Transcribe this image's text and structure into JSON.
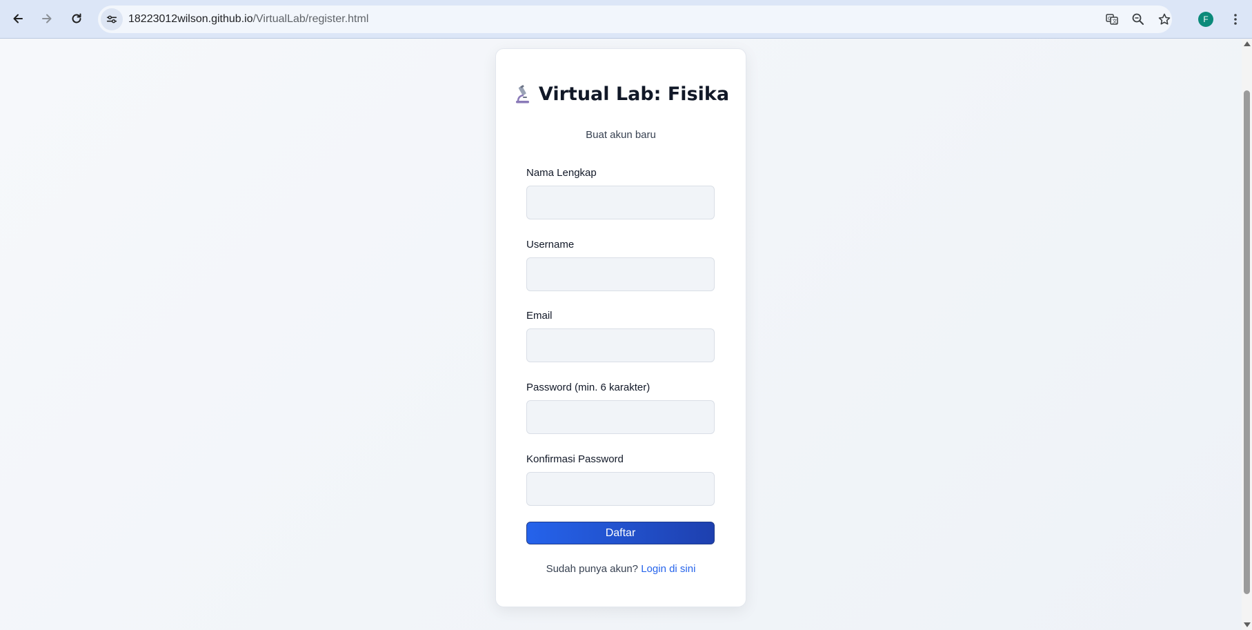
{
  "browser": {
    "url_host": "18223012wilson.github.io",
    "url_path": "/VirtualLab/register.html",
    "profile_initial": "F",
    "icons": [
      "back-icon",
      "forward-icon",
      "reload-icon",
      "site-info-icon",
      "translate-icon",
      "zoom-icon",
      "star-icon",
      "kebab-menu-icon"
    ]
  },
  "page": {
    "title": "Virtual Lab: Fisika",
    "subtitle": "Buat akun baru",
    "fields": [
      {
        "label": "Nama Lengkap",
        "value": ""
      },
      {
        "label": "Username",
        "value": ""
      },
      {
        "label": "Email",
        "value": ""
      },
      {
        "label": "Password (min. 6 karakter)",
        "value": ""
      },
      {
        "label": "Konfirmasi Password",
        "value": ""
      }
    ],
    "submit_label": "Daftar",
    "footer_prompt": "Sudah punya akun?",
    "login_link": "Login di sini"
  },
  "colors": {
    "accent": "#2563eb",
    "accent_dark": "#1e40af",
    "profile": "#0b8a7a"
  }
}
